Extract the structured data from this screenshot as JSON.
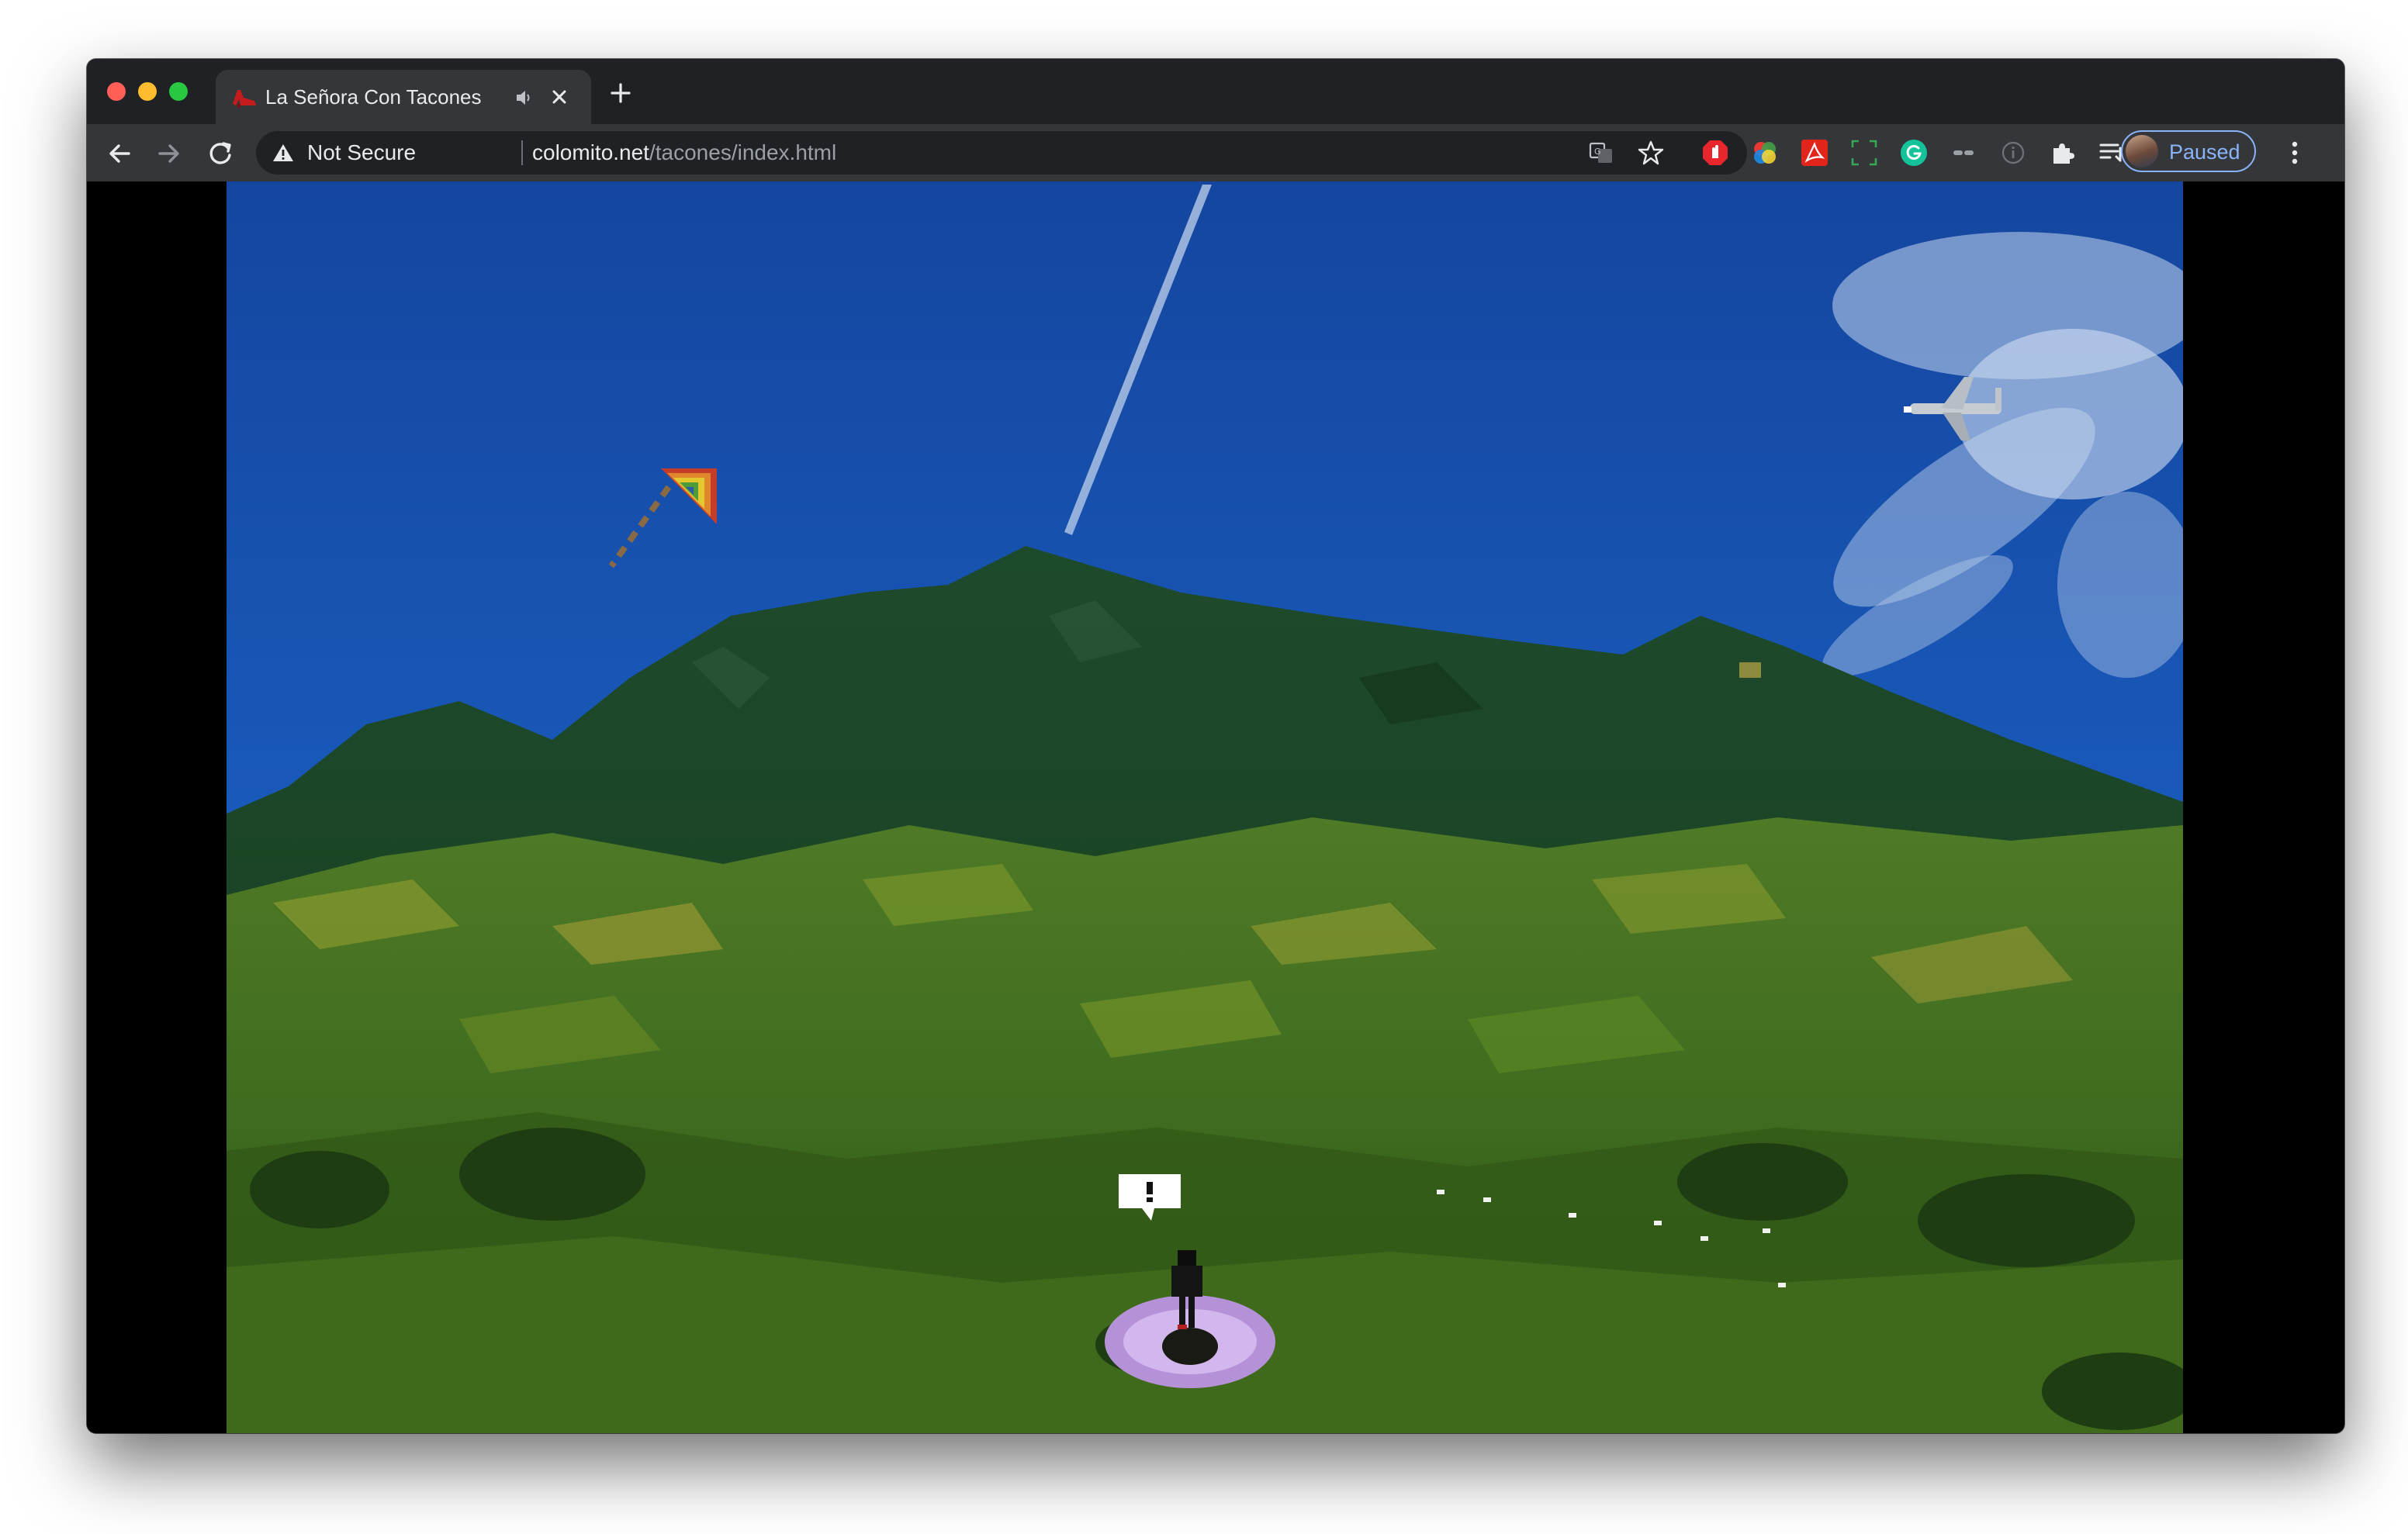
{
  "tab": {
    "title": "La Señora Con Tacones",
    "favicon": "high-heel-shoe-icon",
    "audio_icon": "speaker-icon",
    "close_icon": "close-icon"
  },
  "newtab_icon": "plus-icon",
  "toolbar": {
    "security_label": "Not Secure",
    "url_host": "colomito.net",
    "url_path": "/tacones/index.html"
  },
  "extensions": [
    "translate-icon",
    "bookmark-star-icon",
    "adblock-icon",
    "color-wheel-icon",
    "acrobat-icon",
    "screenshot-icon",
    "grammarly-icon",
    "link-icon",
    "info-icon",
    "puzzle-extensions-icon",
    "reading-list-icon"
  ],
  "profile": {
    "label": "Paused"
  },
  "colors": {
    "tabbar_bg": "#202124",
    "toolbar_bg": "#35363a",
    "omnibox_bg": "#202124",
    "accent": "#8ab4f8",
    "sky": "#1a56b5",
    "mountain": "#1c4a23",
    "hills": "#5a7d22"
  }
}
